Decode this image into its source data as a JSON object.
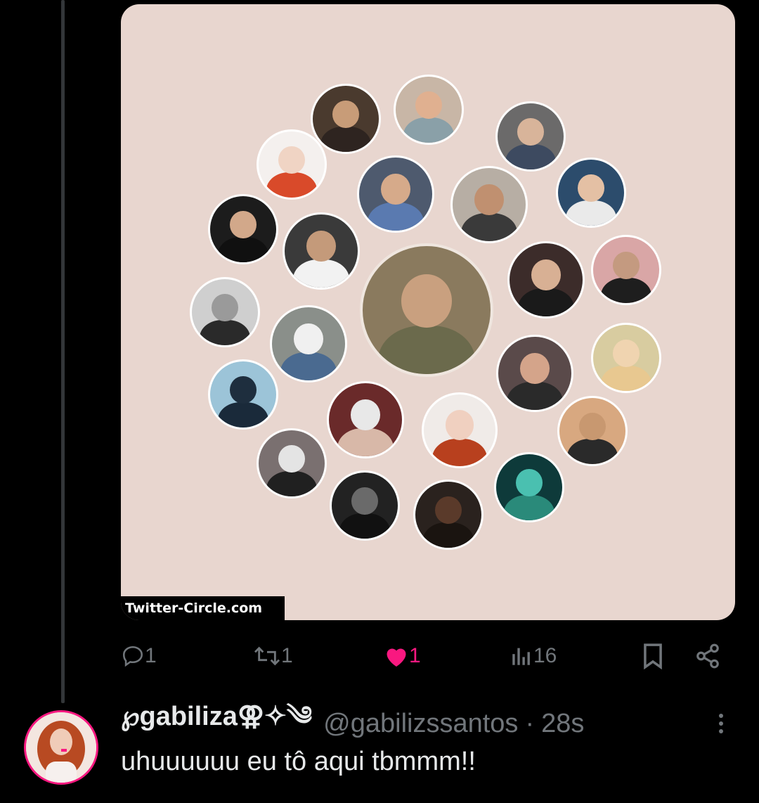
{
  "image_card": {
    "watermark": "Twitter-Circle.com",
    "background": "#e8d6cf"
  },
  "actions": {
    "reply_count": "1",
    "retweet_count": "1",
    "like_count": "1",
    "views_count": "16",
    "like_color": "#f91880",
    "icon_color": "#71767b"
  },
  "reply": {
    "display_name": "℘gabiliza⚢✧༄",
    "handle": "@gabilizssantos",
    "separator": "·",
    "time": "28s",
    "text": "uhuuuuuu eu tô aqui tbmmm!!"
  },
  "circle_avatars": [
    {
      "name": "center-louis",
      "bg": "#8a7a5e",
      "head": "#c9a07f",
      "body": "#6b6a4c"
    },
    {
      "name": "p1",
      "bg": "#4a3a2e",
      "head": "#c89c78",
      "body": "#2e2420"
    },
    {
      "name": "p2",
      "bg": "#c8b6a6",
      "head": "#e0b090",
      "body": "#8aa0a8"
    },
    {
      "name": "p3",
      "bg": "#6b6a6a",
      "head": "#d8b49a",
      "body": "#3d4a60"
    },
    {
      "name": "p4",
      "bg": "#f4f0ee",
      "head": "#f0d4c4",
      "body": "#d94a2a"
    },
    {
      "name": "p5",
      "bg": "#4e5a6e",
      "head": "#d6aa8a",
      "body": "#5a7ab0"
    },
    {
      "name": "p6",
      "bg": "#b7aea4",
      "head": "#c09070",
      "body": "#3a3a3a"
    },
    {
      "name": "p7",
      "bg": "#2c4c6c",
      "head": "#e4c0a4",
      "body": "#eaeaea"
    },
    {
      "name": "p8",
      "bg": "#1c1c1c",
      "head": "#d2a88a",
      "body": "#101010"
    },
    {
      "name": "p9",
      "bg": "#3a3a3a",
      "head": "#c49a7a",
      "body": "#f2f2f2"
    },
    {
      "name": "p10",
      "bg": "#3c2c2a",
      "head": "#d8b094",
      "body": "#1a1a1a"
    },
    {
      "name": "p11",
      "bg": "#d9a6a6",
      "head": "#c49a80",
      "body": "#1e1e1e"
    },
    {
      "name": "p12",
      "bg": "#cfcfcf",
      "head": "#9a9a9a",
      "body": "#2a2a2a"
    },
    {
      "name": "p13",
      "bg": "#8a8f8a",
      "head": "#f0f0f0",
      "body": "#4a6a90"
    },
    {
      "name": "p14",
      "bg": "#d8cca0",
      "head": "#f0d4b0",
      "body": "#e8c890"
    },
    {
      "name": "p15",
      "bg": "#5a4a4a",
      "head": "#d4a48a",
      "body": "#2a2a2a"
    },
    {
      "name": "p16",
      "bg": "#9cc4d8",
      "head": "#1e2e3e",
      "body": "#1a2a3a"
    },
    {
      "name": "p17",
      "bg": "#6a2a2a",
      "head": "#e8e8e8",
      "body": "#d8b8a8"
    },
    {
      "name": "p18",
      "bg": "#f0ebe8",
      "head": "#f0d0c0",
      "body": "#b8401e"
    },
    {
      "name": "p19",
      "bg": "#d8a880",
      "head": "#c89870",
      "body": "#2a2a2a"
    },
    {
      "name": "p20",
      "bg": "#7a7070",
      "head": "#e4e4e4",
      "body": "#202020"
    },
    {
      "name": "p21",
      "bg": "#222",
      "head": "#6a6a6a",
      "body": "#111"
    },
    {
      "name": "p22",
      "bg": "#2a221e",
      "head": "#5a3a2a",
      "body": "#1a1410"
    },
    {
      "name": "p23",
      "bg": "#0e3a3a",
      "head": "#4ac0b0",
      "body": "#2a8a7a"
    }
  ]
}
